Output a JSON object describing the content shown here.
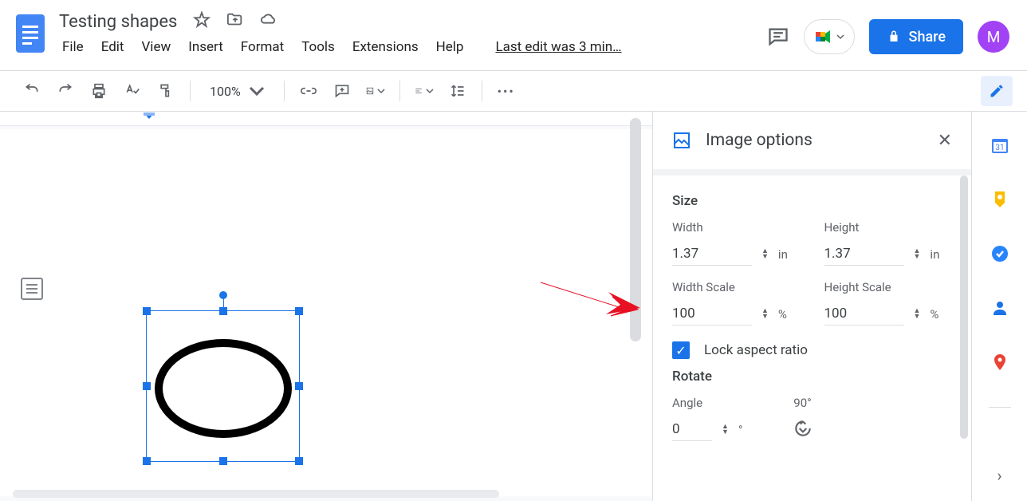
{
  "doc": {
    "title": "Testing shapes",
    "last_edit": "Last edit was 3 min…"
  },
  "menu": {
    "file": "File",
    "edit": "Edit",
    "view": "View",
    "insert": "Insert",
    "format": "Format",
    "tools": "Tools",
    "extensions": "Extensions",
    "help": "Help"
  },
  "header": {
    "share": "Share",
    "avatar": "M"
  },
  "toolbar": {
    "zoom": "100%"
  },
  "panel": {
    "title": "Image options",
    "size_section": "Size",
    "width_label": "Width",
    "width_value": "1.37",
    "width_unit": "in",
    "height_label": "Height",
    "height_value": "1.37",
    "height_unit": "in",
    "width_scale_label": "Width Scale",
    "width_scale_value": "100",
    "width_scale_unit": "%",
    "height_scale_label": "Height Scale",
    "height_scale_value": "100",
    "height_scale_unit": "%",
    "lock_aspect": "Lock aspect ratio",
    "rotate_section": "Rotate",
    "angle_label": "Angle",
    "angle_value": "0",
    "angle_unit": "°",
    "rotate_90_label": "90°"
  }
}
